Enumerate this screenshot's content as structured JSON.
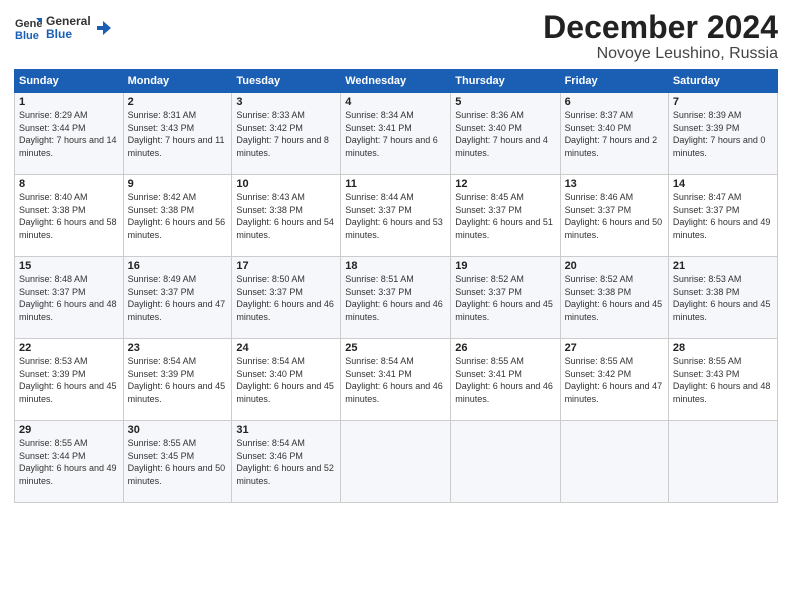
{
  "header": {
    "logo_line1": "General",
    "logo_line2": "Blue",
    "month": "December 2024",
    "location": "Novoye Leushino, Russia"
  },
  "weekdays": [
    "Sunday",
    "Monday",
    "Tuesday",
    "Wednesday",
    "Thursday",
    "Friday",
    "Saturday"
  ],
  "weeks": [
    [
      {
        "day": "1",
        "sunrise": "Sunrise: 8:29 AM",
        "sunset": "Sunset: 3:44 PM",
        "daylight": "Daylight: 7 hours and 14 minutes."
      },
      {
        "day": "2",
        "sunrise": "Sunrise: 8:31 AM",
        "sunset": "Sunset: 3:43 PM",
        "daylight": "Daylight: 7 hours and 11 minutes."
      },
      {
        "day": "3",
        "sunrise": "Sunrise: 8:33 AM",
        "sunset": "Sunset: 3:42 PM",
        "daylight": "Daylight: 7 hours and 8 minutes."
      },
      {
        "day": "4",
        "sunrise": "Sunrise: 8:34 AM",
        "sunset": "Sunset: 3:41 PM",
        "daylight": "Daylight: 7 hours and 6 minutes."
      },
      {
        "day": "5",
        "sunrise": "Sunrise: 8:36 AM",
        "sunset": "Sunset: 3:40 PM",
        "daylight": "Daylight: 7 hours and 4 minutes."
      },
      {
        "day": "6",
        "sunrise": "Sunrise: 8:37 AM",
        "sunset": "Sunset: 3:40 PM",
        "daylight": "Daylight: 7 hours and 2 minutes."
      },
      {
        "day": "7",
        "sunrise": "Sunrise: 8:39 AM",
        "sunset": "Sunset: 3:39 PM",
        "daylight": "Daylight: 7 hours and 0 minutes."
      }
    ],
    [
      {
        "day": "8",
        "sunrise": "Sunrise: 8:40 AM",
        "sunset": "Sunset: 3:38 PM",
        "daylight": "Daylight: 6 hours and 58 minutes."
      },
      {
        "day": "9",
        "sunrise": "Sunrise: 8:42 AM",
        "sunset": "Sunset: 3:38 PM",
        "daylight": "Daylight: 6 hours and 56 minutes."
      },
      {
        "day": "10",
        "sunrise": "Sunrise: 8:43 AM",
        "sunset": "Sunset: 3:38 PM",
        "daylight": "Daylight: 6 hours and 54 minutes."
      },
      {
        "day": "11",
        "sunrise": "Sunrise: 8:44 AM",
        "sunset": "Sunset: 3:37 PM",
        "daylight": "Daylight: 6 hours and 53 minutes."
      },
      {
        "day": "12",
        "sunrise": "Sunrise: 8:45 AM",
        "sunset": "Sunset: 3:37 PM",
        "daylight": "Daylight: 6 hours and 51 minutes."
      },
      {
        "day": "13",
        "sunrise": "Sunrise: 8:46 AM",
        "sunset": "Sunset: 3:37 PM",
        "daylight": "Daylight: 6 hours and 50 minutes."
      },
      {
        "day": "14",
        "sunrise": "Sunrise: 8:47 AM",
        "sunset": "Sunset: 3:37 PM",
        "daylight": "Daylight: 6 hours and 49 minutes."
      }
    ],
    [
      {
        "day": "15",
        "sunrise": "Sunrise: 8:48 AM",
        "sunset": "Sunset: 3:37 PM",
        "daylight": "Daylight: 6 hours and 48 minutes."
      },
      {
        "day": "16",
        "sunrise": "Sunrise: 8:49 AM",
        "sunset": "Sunset: 3:37 PM",
        "daylight": "Daylight: 6 hours and 47 minutes."
      },
      {
        "day": "17",
        "sunrise": "Sunrise: 8:50 AM",
        "sunset": "Sunset: 3:37 PM",
        "daylight": "Daylight: 6 hours and 46 minutes."
      },
      {
        "day": "18",
        "sunrise": "Sunrise: 8:51 AM",
        "sunset": "Sunset: 3:37 PM",
        "daylight": "Daylight: 6 hours and 46 minutes."
      },
      {
        "day": "19",
        "sunrise": "Sunrise: 8:52 AM",
        "sunset": "Sunset: 3:37 PM",
        "daylight": "Daylight: 6 hours and 45 minutes."
      },
      {
        "day": "20",
        "sunrise": "Sunrise: 8:52 AM",
        "sunset": "Sunset: 3:38 PM",
        "daylight": "Daylight: 6 hours and 45 minutes."
      },
      {
        "day": "21",
        "sunrise": "Sunrise: 8:53 AM",
        "sunset": "Sunset: 3:38 PM",
        "daylight": "Daylight: 6 hours and 45 minutes."
      }
    ],
    [
      {
        "day": "22",
        "sunrise": "Sunrise: 8:53 AM",
        "sunset": "Sunset: 3:39 PM",
        "daylight": "Daylight: 6 hours and 45 minutes."
      },
      {
        "day": "23",
        "sunrise": "Sunrise: 8:54 AM",
        "sunset": "Sunset: 3:39 PM",
        "daylight": "Daylight: 6 hours and 45 minutes."
      },
      {
        "day": "24",
        "sunrise": "Sunrise: 8:54 AM",
        "sunset": "Sunset: 3:40 PM",
        "daylight": "Daylight: 6 hours and 45 minutes."
      },
      {
        "day": "25",
        "sunrise": "Sunrise: 8:54 AM",
        "sunset": "Sunset: 3:41 PM",
        "daylight": "Daylight: 6 hours and 46 minutes."
      },
      {
        "day": "26",
        "sunrise": "Sunrise: 8:55 AM",
        "sunset": "Sunset: 3:41 PM",
        "daylight": "Daylight: 6 hours and 46 minutes."
      },
      {
        "day": "27",
        "sunrise": "Sunrise: 8:55 AM",
        "sunset": "Sunset: 3:42 PM",
        "daylight": "Daylight: 6 hours and 47 minutes."
      },
      {
        "day": "28",
        "sunrise": "Sunrise: 8:55 AM",
        "sunset": "Sunset: 3:43 PM",
        "daylight": "Daylight: 6 hours and 48 minutes."
      }
    ],
    [
      {
        "day": "29",
        "sunrise": "Sunrise: 8:55 AM",
        "sunset": "Sunset: 3:44 PM",
        "daylight": "Daylight: 6 hours and 49 minutes."
      },
      {
        "day": "30",
        "sunrise": "Sunrise: 8:55 AM",
        "sunset": "Sunset: 3:45 PM",
        "daylight": "Daylight: 6 hours and 50 minutes."
      },
      {
        "day": "31",
        "sunrise": "Sunrise: 8:54 AM",
        "sunset": "Sunset: 3:46 PM",
        "daylight": "Daylight: 6 hours and 52 minutes."
      },
      null,
      null,
      null,
      null
    ]
  ]
}
